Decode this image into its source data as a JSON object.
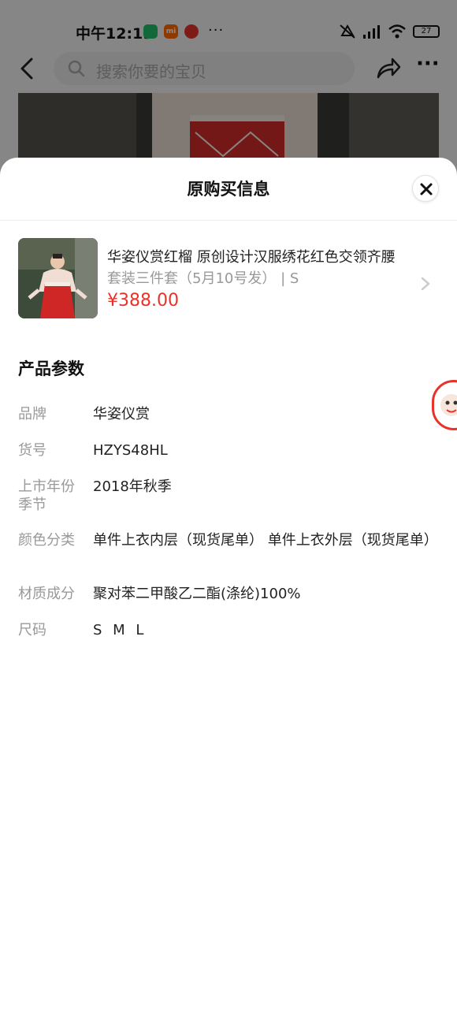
{
  "status_bar": {
    "time": "中午12:19",
    "app_badge_2": "mi",
    "more_dots": "···",
    "battery": "27"
  },
  "nav": {
    "search_placeholder": "搜索你要的宝贝"
  },
  "sheet": {
    "title": "原购买信息"
  },
  "product": {
    "title": "华姿仪赏红榴 原创设计汉服绣花红色交领齐腰",
    "sku": "套装三件套（5月10号发） | S",
    "price": "¥388.00"
  },
  "params": {
    "heading": "产品参数",
    "rows": [
      {
        "key": "品牌",
        "value": "华姿仪赏"
      },
      {
        "key": "货号",
        "value": "HZYS48HL"
      },
      {
        "key": "上市年份季节",
        "value": "2018年秋季"
      },
      {
        "key": "颜色分类",
        "value": "单件上衣内层（现货尾单） 单件上衣外层（现货尾单）"
      },
      {
        "key": "材质成分",
        "value": "聚对苯二甲酸乙二酯(涤纶)100%"
      },
      {
        "key": "尺码",
        "value": "S M L"
      }
    ]
  },
  "colors": {
    "price_red": "#e8322a",
    "label_gray": "#999999"
  }
}
